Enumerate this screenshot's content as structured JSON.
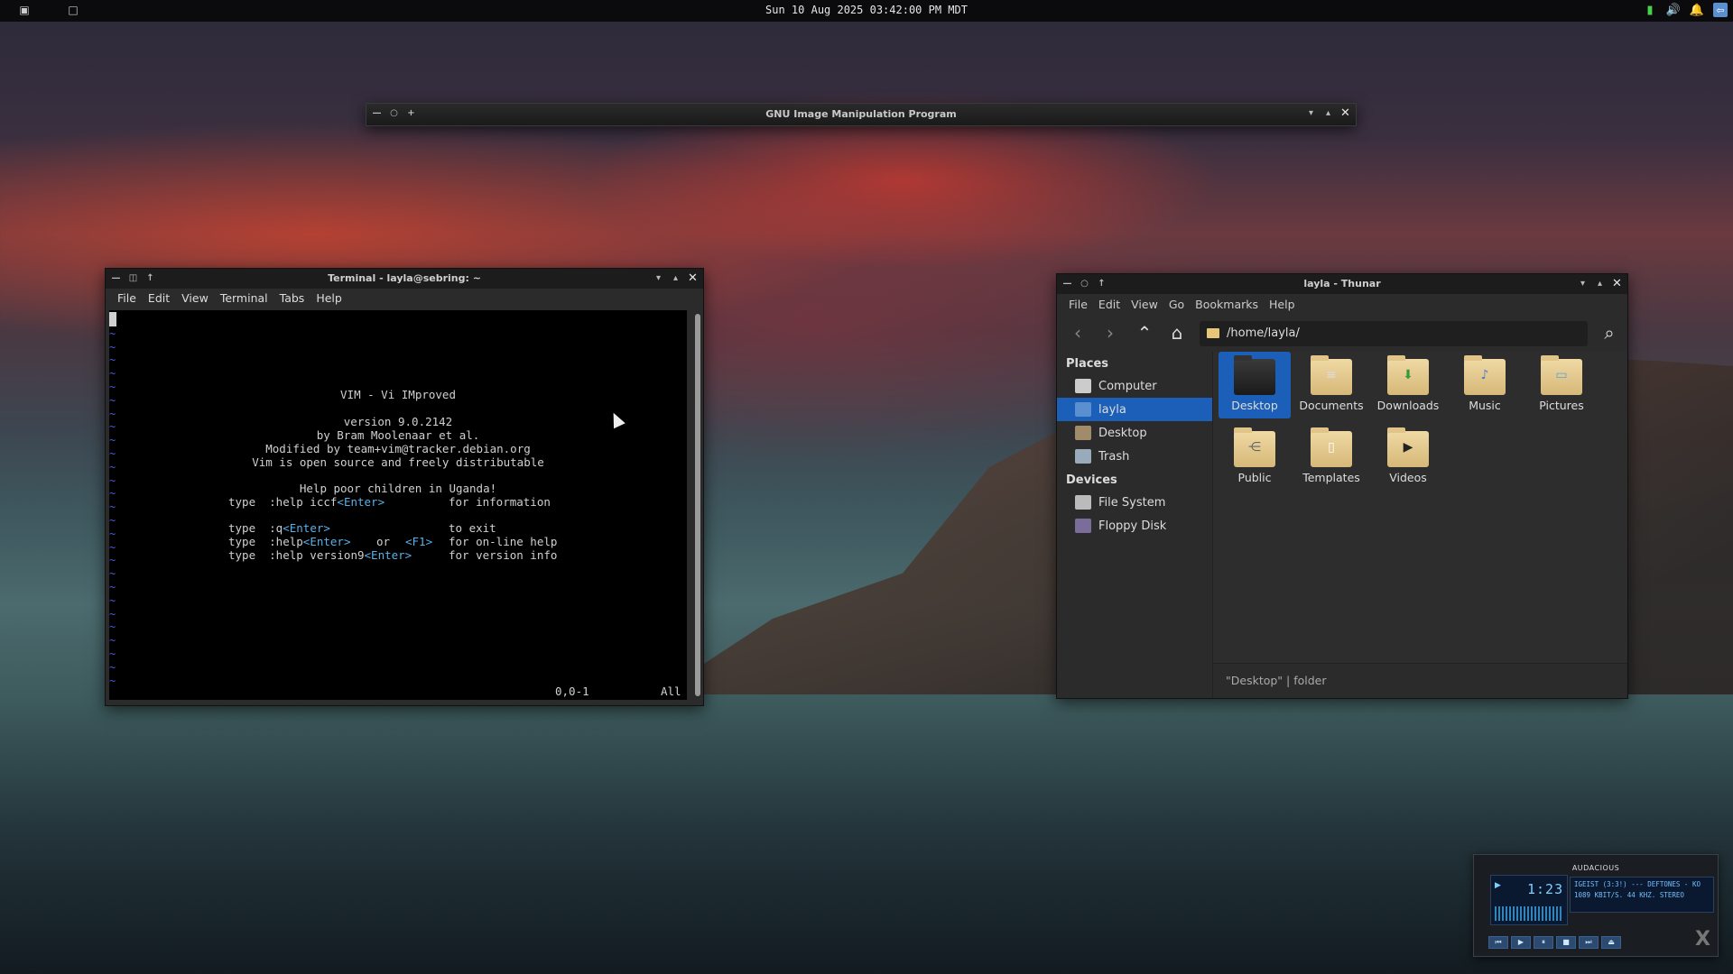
{
  "panel": {
    "clock": "Sun 10 Aug 2025 03:42:00 PM MDT",
    "tray_icons": [
      "network-icon",
      "volume-icon",
      "notification-icon",
      "logout-icon"
    ]
  },
  "gimp": {
    "title": "GNU Image Manipulation Program"
  },
  "terminal": {
    "title": "Terminal - layla@sebring: ~",
    "menu": [
      "File",
      "Edit",
      "View",
      "Terminal",
      "Tabs",
      "Help"
    ],
    "vim": {
      "line1": "VIM - Vi IMproved",
      "line2": "version 9.0.2142",
      "line3": "by Bram Moolenaar et al.",
      "line4": "Modified by team+vim@tracker.debian.org",
      "line5": "Vim is open source and freely distributable",
      "line6": "Help poor children in Uganda!",
      "help_iccf_cmd": "type  :help iccf",
      "help_iccf_key": "<Enter>",
      "help_iccf_desc": "for information",
      "quit_cmd": "type  :q",
      "quit_key": "<Enter>",
      "quit_desc": "to exit",
      "help_cmd": "type  :help",
      "help_key": "<Enter>",
      "help_or": "or",
      "help_f1": "<F1>",
      "help_desc": "for on-line help",
      "ver_cmd": "type  :help version9",
      "ver_key": "<Enter>",
      "ver_desc": "for version info",
      "pos": "0,0-1",
      "all": "All"
    }
  },
  "thunar": {
    "title": "layla - Thunar",
    "menu": [
      "File",
      "Edit",
      "View",
      "Go",
      "Bookmarks",
      "Help"
    ],
    "path": "/home/layla/",
    "places_heading": "Places",
    "places": [
      "Computer",
      "layla",
      "Desktop",
      "Trash"
    ],
    "devices_heading": "Devices",
    "devices": [
      "File System",
      "Floppy Disk"
    ],
    "folders": [
      "Desktop",
      "Documents",
      "Downloads",
      "Music",
      "Pictures",
      "Public",
      "Templates",
      "Videos"
    ],
    "status": "\"Desktop\"  |  folder",
    "selected_color": "#1b5fb8"
  },
  "audacious": {
    "title": "AUDACIOUS",
    "time": "1:23",
    "track": "IGEIST (3:3!) --- DEFTONES - KO",
    "info": "1089 KBIT/S. 44 KHZ. STEREO"
  }
}
